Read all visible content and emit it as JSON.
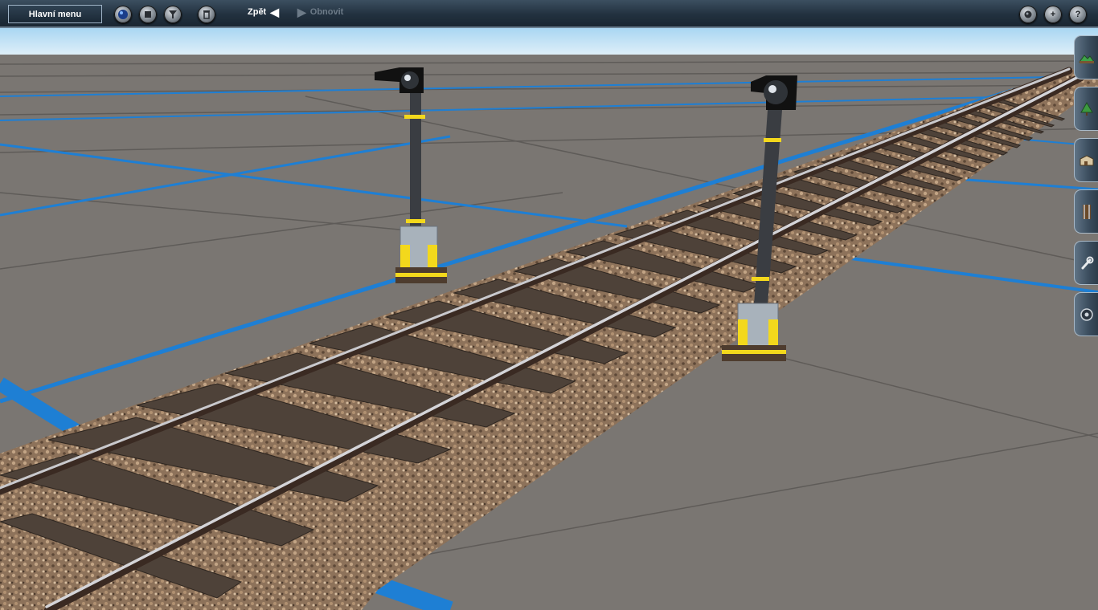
{
  "toolbar": {
    "main_menu_label": "Hlavní menu",
    "undo_label": "Zpět",
    "redo_label": "Obnovit",
    "left_icons": [
      "globe-icon",
      "stop-icon",
      "filter-icon",
      "trash-icon"
    ],
    "right_icons": [
      "camera-icon",
      "add-icon",
      "help-icon"
    ],
    "help_glyph": "?",
    "add_glyph": "+"
  },
  "side_tabs": [
    {
      "icon": "terrain-tool-icon"
    },
    {
      "icon": "trees-tool-icon"
    },
    {
      "icon": "objects-tool-icon"
    },
    {
      "icon": "track-tool-icon"
    },
    {
      "icon": "wrench-tool-icon"
    },
    {
      "icon": "settings-tool-icon"
    }
  ],
  "colors": {
    "ground": "#7a7672",
    "grid_blue": "#1e7fd4",
    "sky": "#bfe0f3",
    "ballast": "#8a6e52",
    "signal_yellow": "#f3d81c"
  }
}
